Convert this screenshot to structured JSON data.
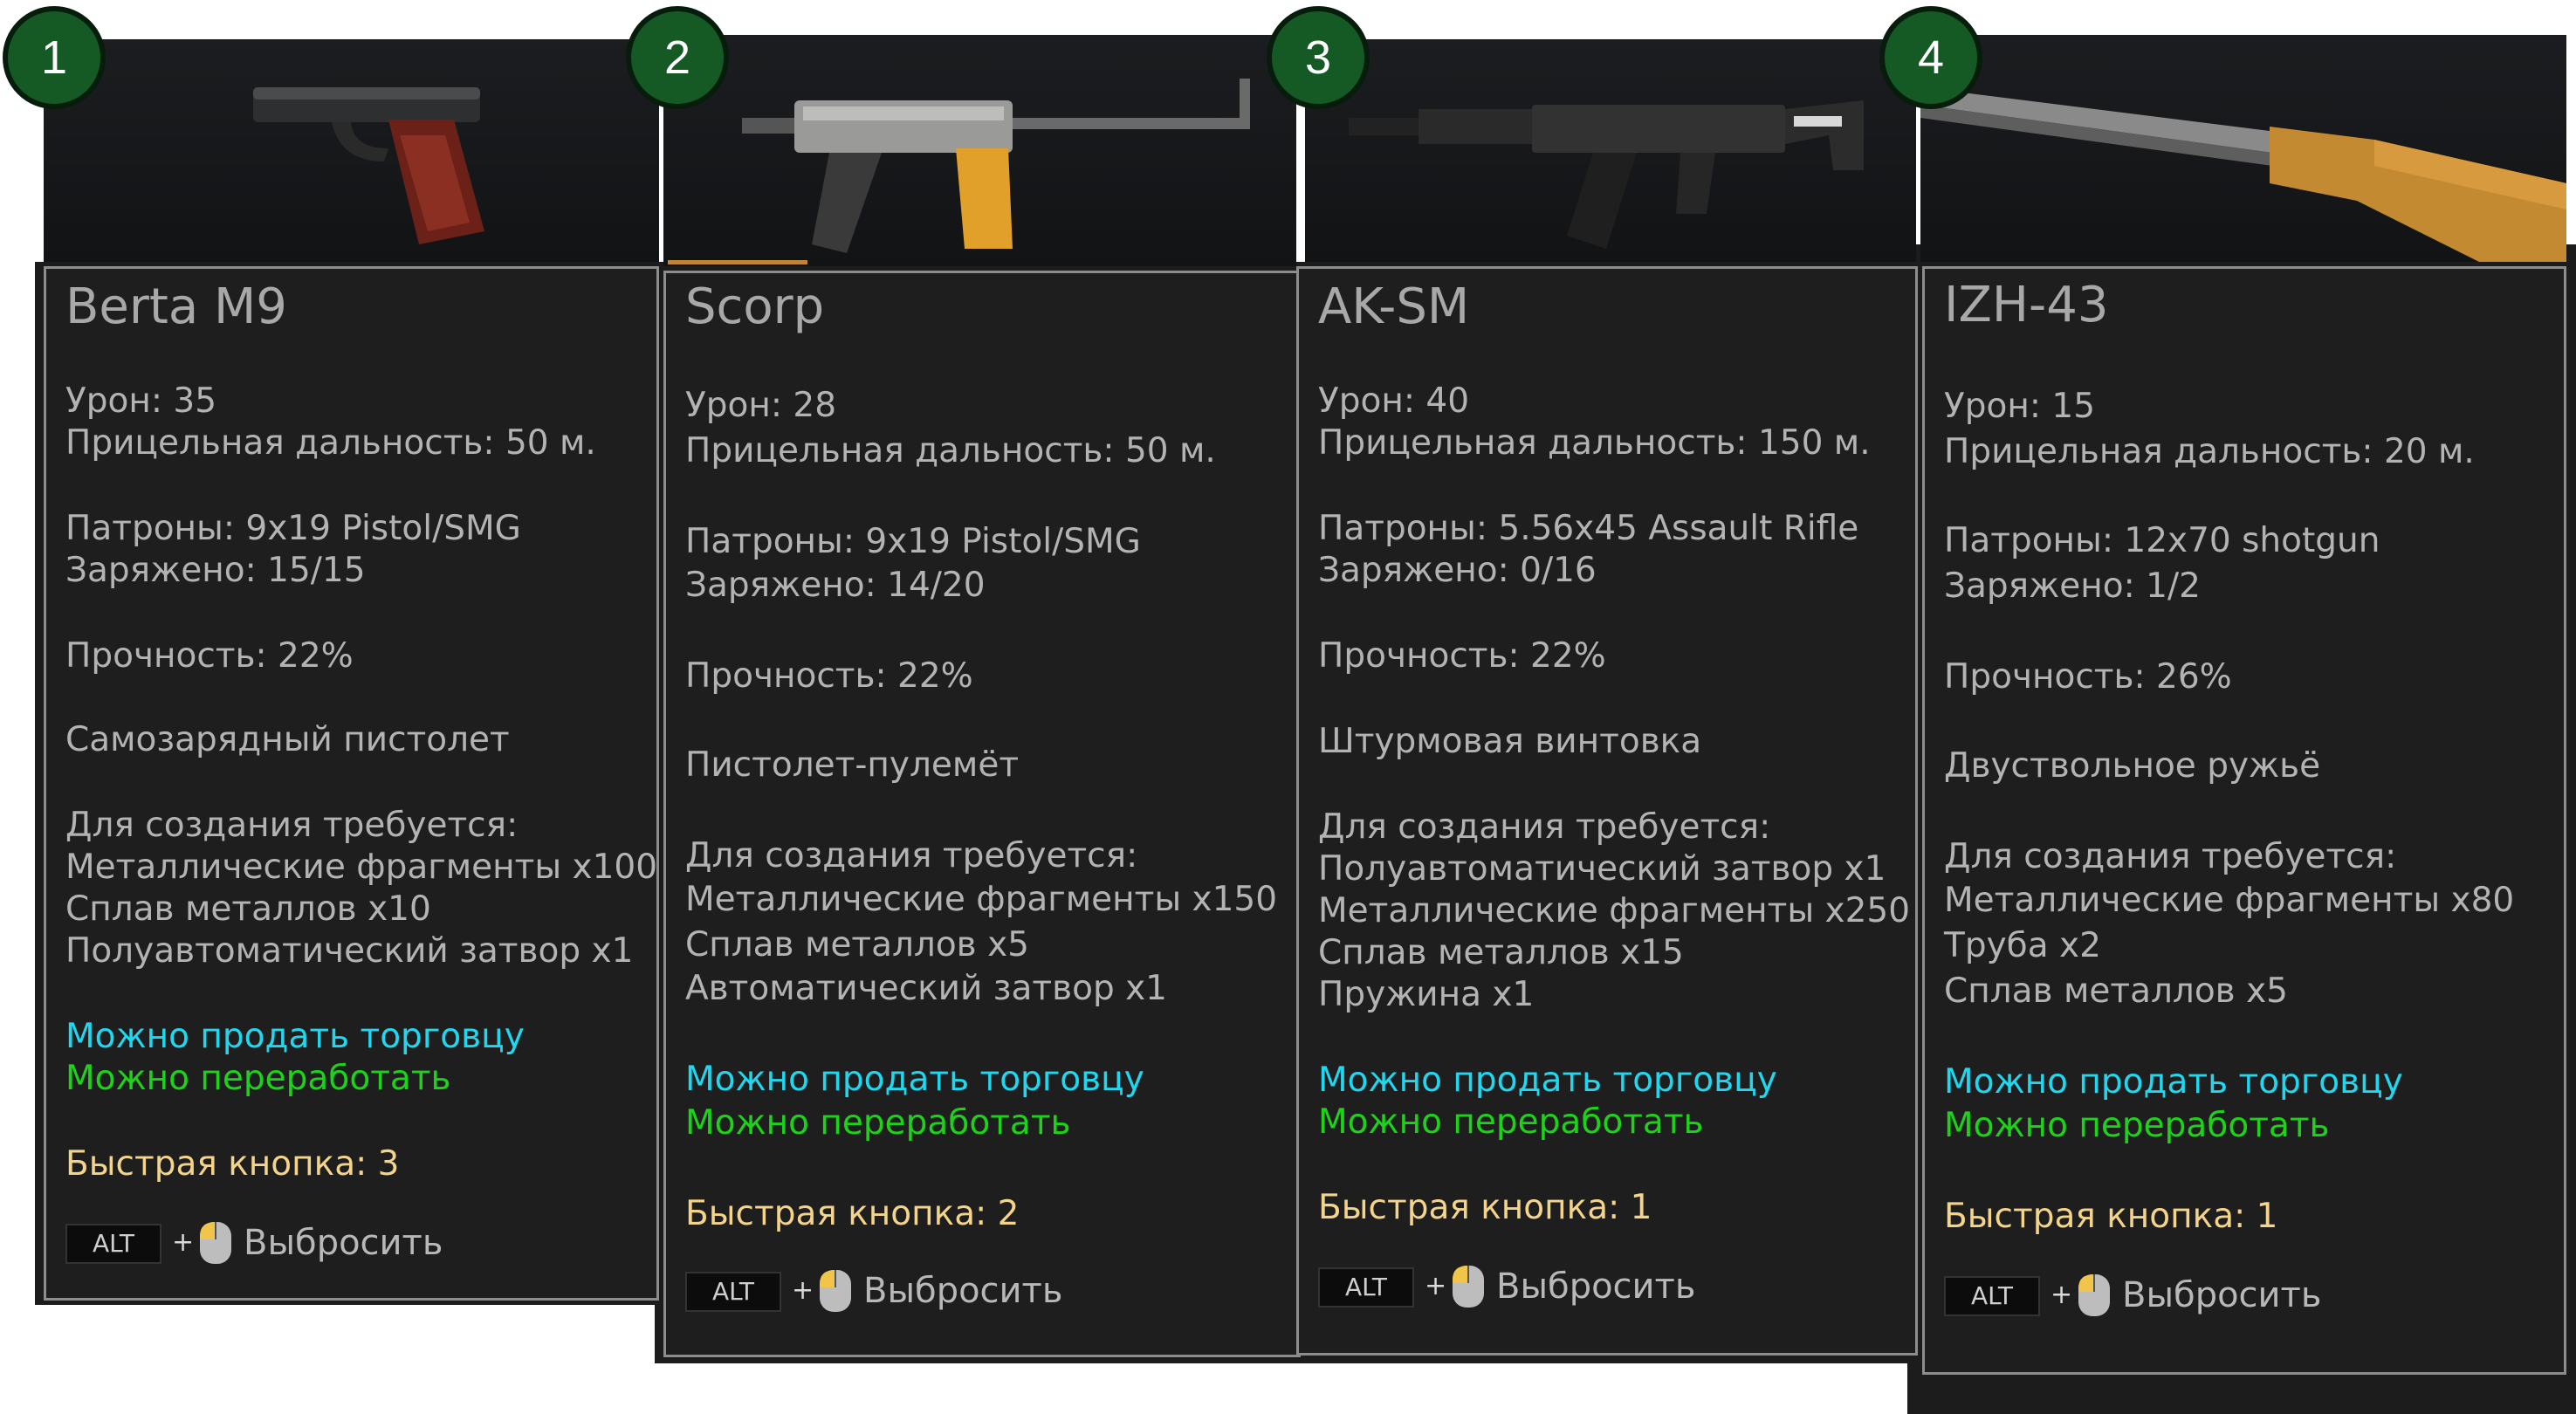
{
  "cards": [
    {
      "badge": "1",
      "name": "Berta M9",
      "damage": "Урон: 35",
      "range": "Прицельная дальность: 50 м.",
      "ammo": "Патроны: 9x19 Pistol/SMG",
      "loaded": "Заряжено: 15/15",
      "durability": "Прочность: 22%",
      "type": "Самозарядный пистолет",
      "craft_header": "Для создания требуется:",
      "craft_items": [
        "Металлические фрагменты x100",
        "Сплав металлов x10",
        "Полуавтоматический затвор x1"
      ],
      "sell": "Можно продать торговцу",
      "recycle": "Можно переработать",
      "hotkey": "Быстрая кнопка: 3",
      "drop_key": "ALT",
      "drop_plus": "+",
      "drop_label": "Выбросить"
    },
    {
      "badge": "2",
      "name": "Scorp",
      "damage": "Урон: 28",
      "range": "Прицельная дальность: 50 м.",
      "ammo": "Патроны: 9x19 Pistol/SMG",
      "loaded": "Заряжено: 14/20",
      "durability": "Прочность: 22%",
      "type": "Пистолет-пулемёт",
      "craft_header": "Для создания требуется:",
      "craft_items": [
        "Металлические фрагменты x150",
        "Сплав металлов x5",
        "Автоматический затвор x1"
      ],
      "sell": "Можно продать торговцу",
      "recycle": "Можно переработать",
      "hotkey": "Быстрая кнопка: 2",
      "drop_key": "ALT",
      "drop_plus": "+",
      "drop_label": "Выбросить"
    },
    {
      "badge": "3",
      "name": "AK-SM",
      "damage": "Урон: 40",
      "range": "Прицельная дальность: 150 м.",
      "ammo": "Патроны: 5.56x45 Assault Rifle",
      "loaded": "Заряжено: 0/16",
      "durability": "Прочность: 22%",
      "type": "Штурмовая винтовка",
      "craft_header": "Для создания требуется:",
      "craft_items": [
        "Полуавтоматический затвор x1",
        "Металлические фрагменты x250",
        "Сплав металлов x15",
        "Пружина x1"
      ],
      "sell": "Можно продать торговцу",
      "recycle": "Можно переработать",
      "hotkey": "Быстрая кнопка: 1",
      "drop_key": "ALT",
      "drop_plus": "+",
      "drop_label": "Выбросить"
    },
    {
      "badge": "4",
      "name": "IZH-43",
      "damage": "Урон: 15",
      "range": "Прицельная дальность: 20 м.",
      "ammo": "Патроны: 12x70 shotgun",
      "loaded": "Заряжено: 1/2",
      "durability": "Прочность: 26%",
      "type": "Двуствольное ружьё",
      "craft_header": "Для создания требуется:",
      "craft_items": [
        "Металлические фрагменты x80",
        "Труба x2",
        "Сплав металлов x5"
      ],
      "sell": "Можно продать торговцу",
      "recycle": "Можно переработать",
      "hotkey": "Быстрая кнопка: 1",
      "drop_key": "ALT",
      "drop_plus": "+",
      "drop_label": "Выбросить"
    }
  ],
  "colors": {
    "sell": "#1fd7ee",
    "recycle": "#1dd31a",
    "hotkey": "#f3d48a",
    "badge": "#155a25"
  },
  "icons": [
    "pistol-icon",
    "smg-icon",
    "rifle-icon",
    "shotgun-icon",
    "mouse-icon"
  ]
}
